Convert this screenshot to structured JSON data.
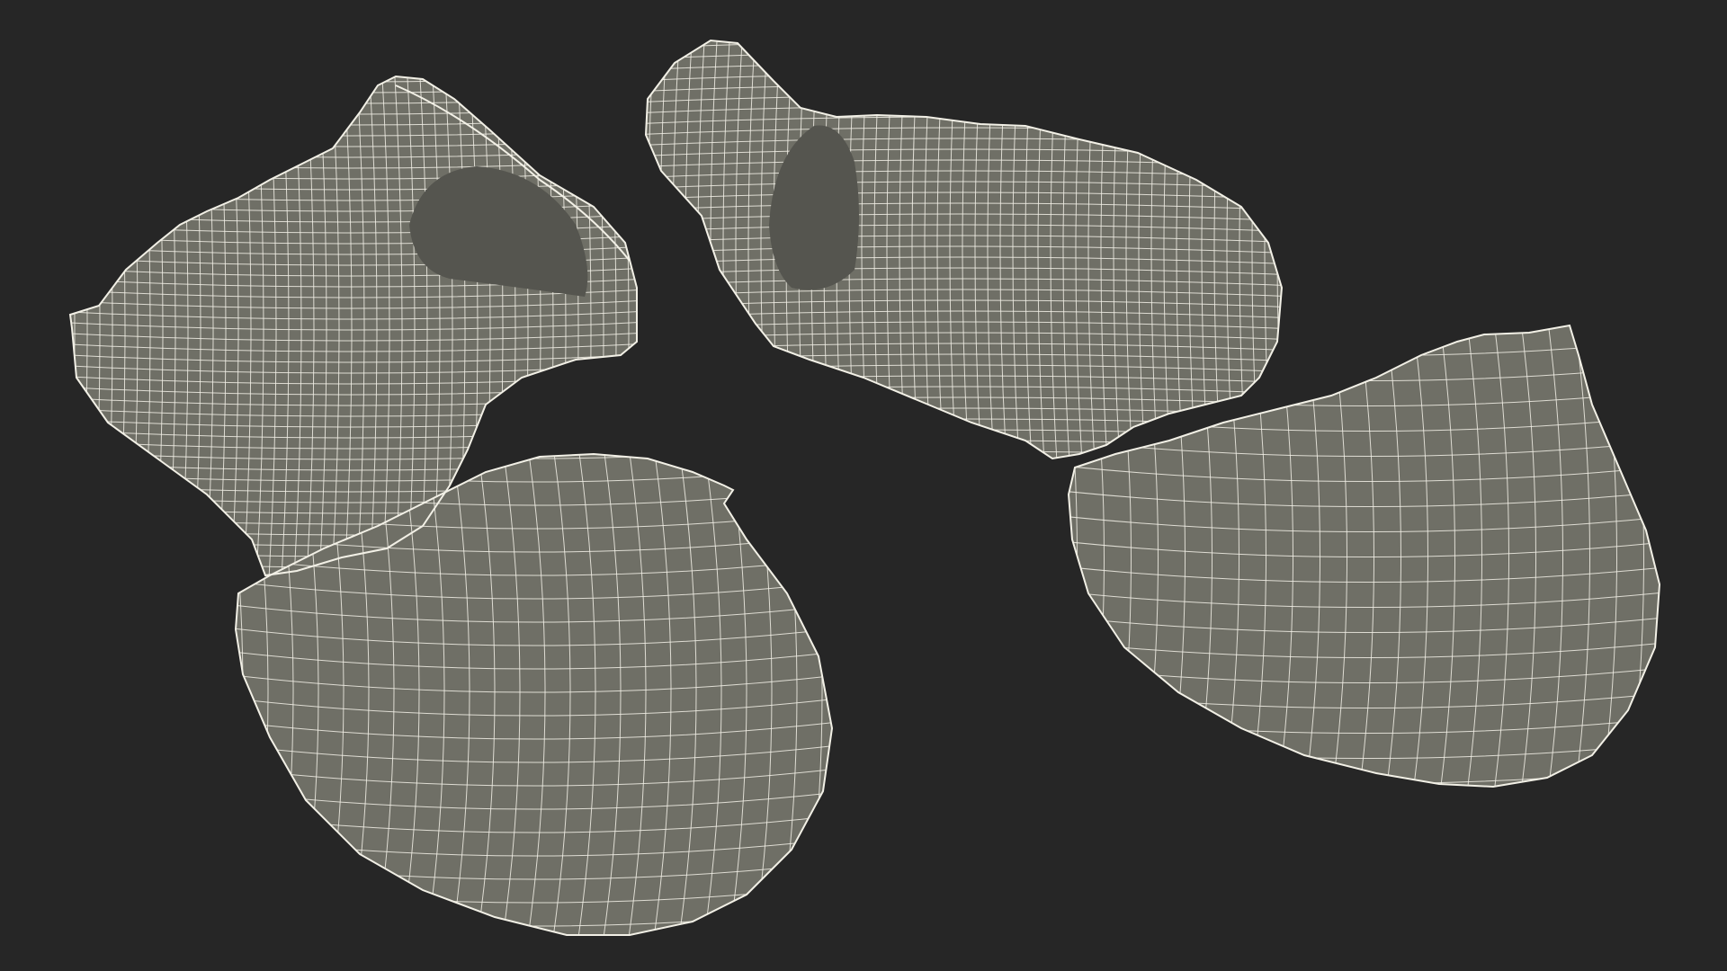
{
  "scene": {
    "background_color": "#262626",
    "mesh_fill_color": "#6f6f66",
    "mesh_shadow_color": "#4d4d47",
    "wireframe_color": "#f2f0e6",
    "objects": [
      {
        "name": "left-mesh-part",
        "description_icon": "wireframe-mesh-icon"
      },
      {
        "name": "right-mesh-part",
        "description_icon": "wireframe-mesh-icon"
      }
    ]
  }
}
